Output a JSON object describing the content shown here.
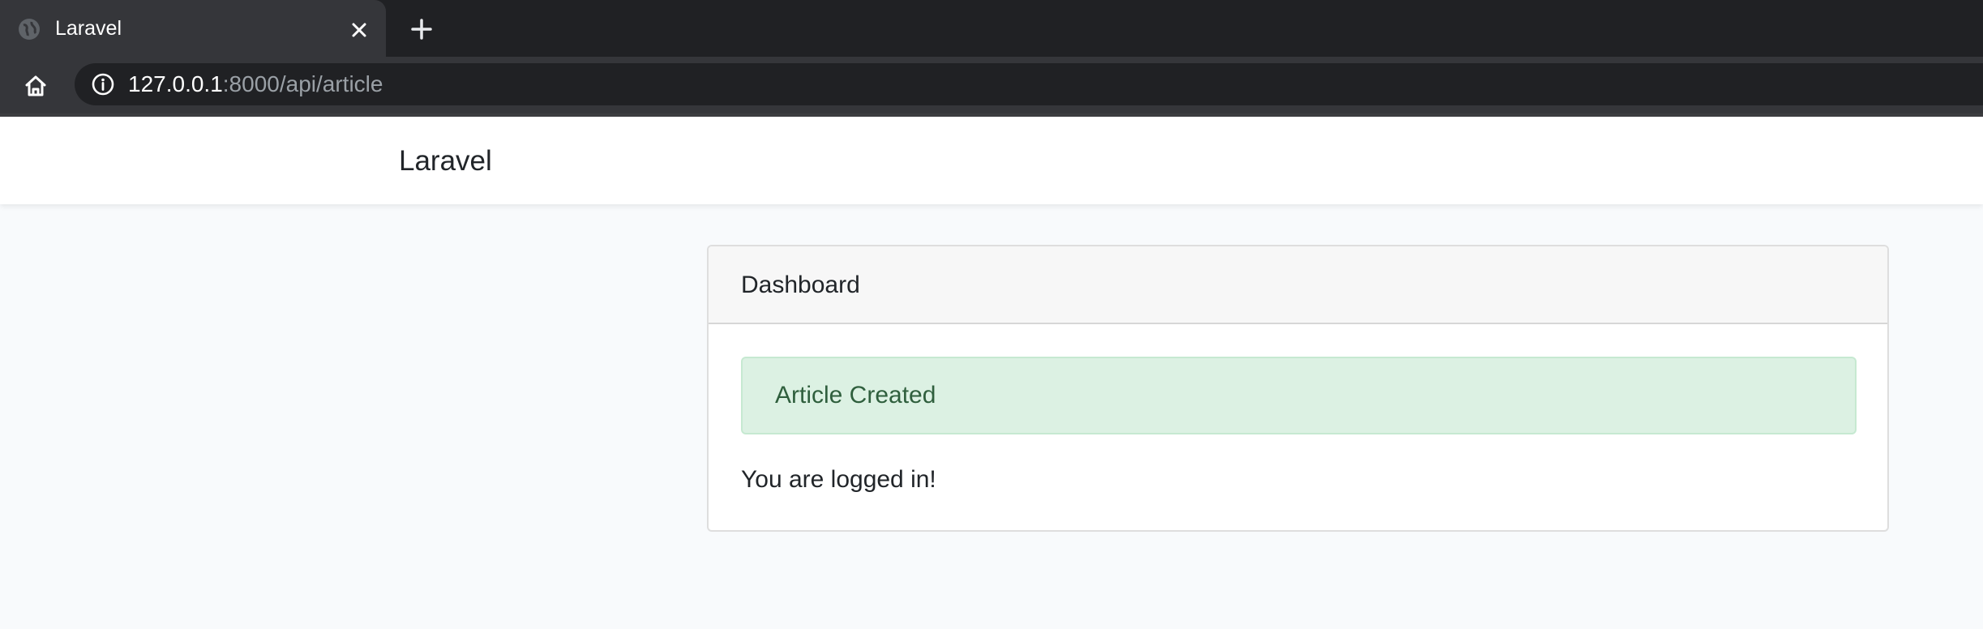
{
  "browser": {
    "tab": {
      "title": "Laravel",
      "favicon_icon": "globe-icon",
      "close_icon": "close-icon"
    },
    "new_tab_icon": "plus-icon",
    "toolbar": {
      "home_icon": "home-icon",
      "site_info_icon": "info-icon",
      "url_host": "127.0.0.1",
      "url_rest": ":8000/api/article"
    }
  },
  "page": {
    "navbar": {
      "brand": "Laravel"
    },
    "card": {
      "header": "Dashboard",
      "alert": "Article Created",
      "message": "You are logged in!"
    }
  },
  "colors": {
    "chrome_dark": "#202124",
    "chrome_tab": "#35363a",
    "page_background": "#f8fafc",
    "alert_background": "#dcf1e3",
    "alert_text": "#2f5f3d"
  }
}
